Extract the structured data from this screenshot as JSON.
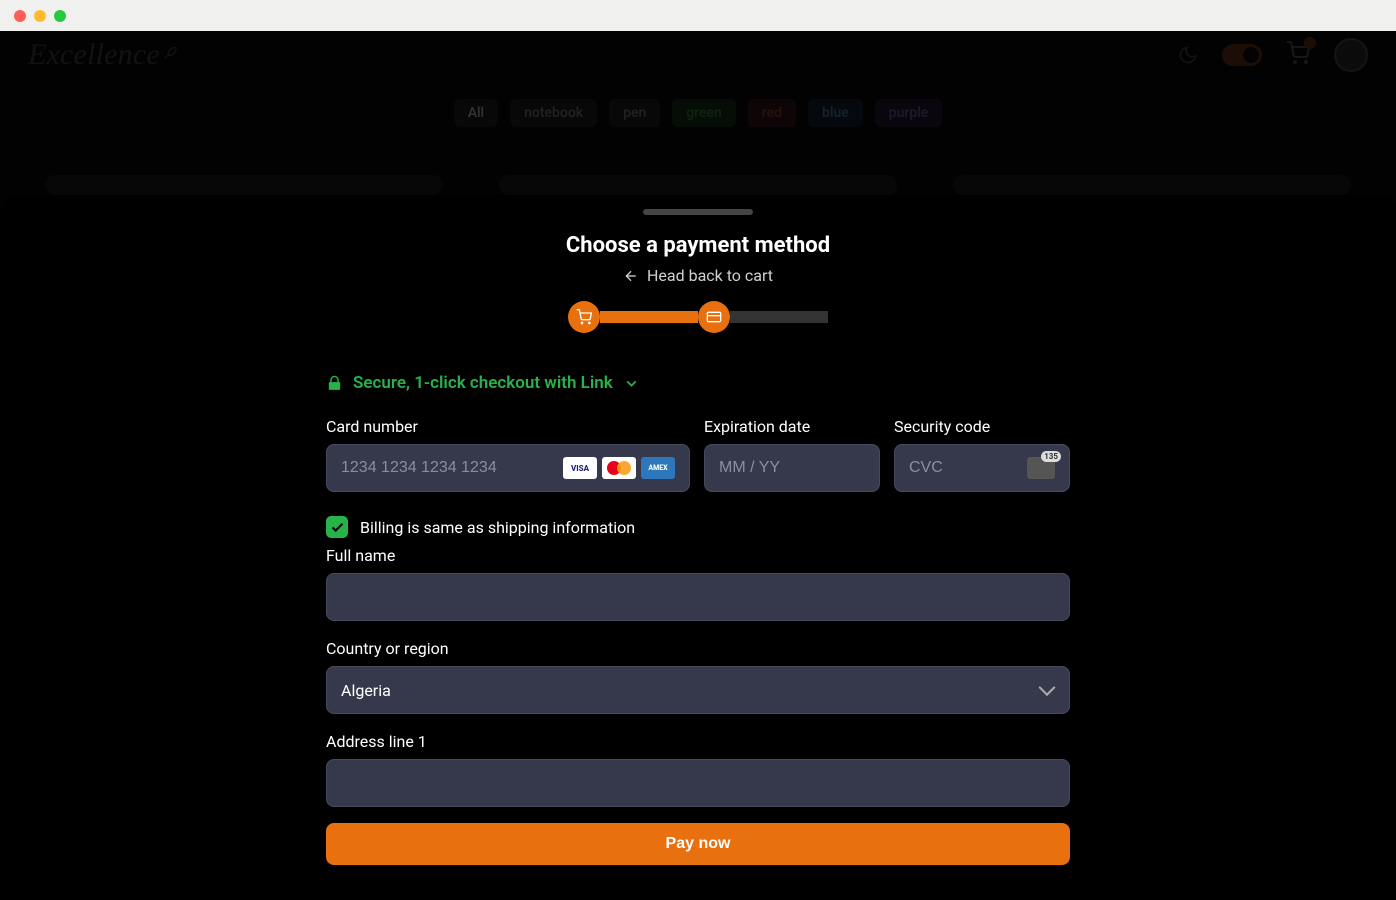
{
  "brand": "Excellence",
  "chips": [
    "All",
    "notebook",
    "pen",
    "green",
    "red",
    "blue",
    "purple"
  ],
  "sheet": {
    "title": "Choose a payment method",
    "back": "Head back to cart",
    "link_text": "Secure, 1-click checkout with Link",
    "card_label": "Card number",
    "card_placeholder": "1234 1234 1234 1234",
    "exp_label": "Expiration date",
    "exp_placeholder": "MM / YY",
    "cvc_label": "Security code",
    "cvc_placeholder": "CVC",
    "billing_same": "Billing is same as shipping information",
    "fullname_label": "Full name",
    "country_label": "Country or region",
    "country_value": "Algeria",
    "address_label": "Address line 1",
    "pay_button": "Pay now"
  },
  "card_brands": {
    "visa": "VISA",
    "amex": "AMEX"
  },
  "colors": {
    "accent": "#e8700e",
    "success": "#28b34a",
    "input_bg": "#36394b"
  }
}
